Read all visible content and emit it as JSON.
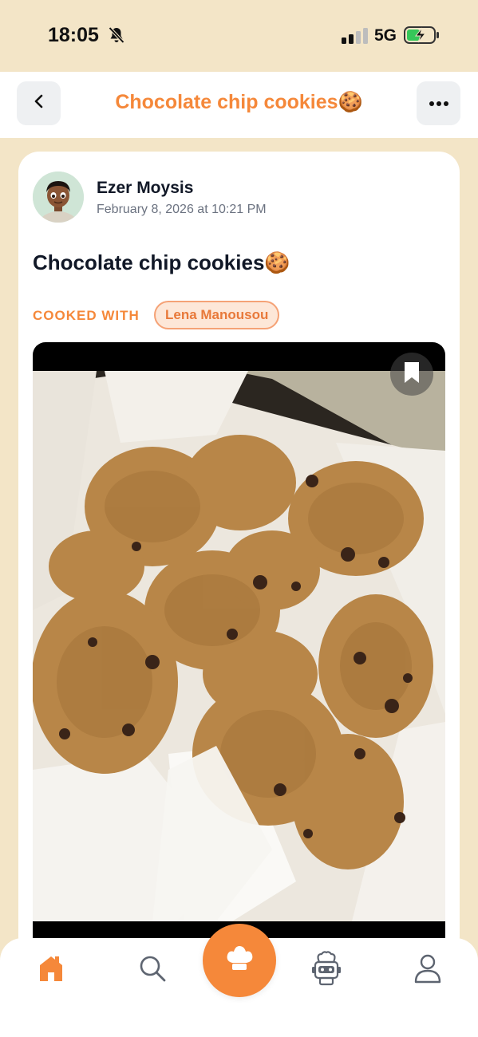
{
  "status_bar": {
    "time": "18:05",
    "network": "5G",
    "icons": [
      "bell-slash-icon",
      "signal-icon",
      "battery-charging-icon"
    ]
  },
  "header": {
    "title": "Chocolate chip cookies🍪",
    "back_icon": "chevron-left-icon",
    "more_icon": "more-horizontal-icon"
  },
  "post": {
    "author": "Ezer Moysis",
    "date": "February 8, 2026 at 10:21 PM",
    "title": "Chocolate chip cookies🍪",
    "cooked_with_label": "COOKED WITH",
    "collaborator": "Lena Manousou",
    "photo": {
      "subject": "cookie-photo",
      "bookmark_icon": "bookmark-icon"
    }
  },
  "tab_bar": {
    "tabs": [
      {
        "icon": "home-icon",
        "active": true
      },
      {
        "icon": "search-icon",
        "active": false
      },
      {
        "icon": "chef-hat-icon",
        "active": false
      },
      {
        "icon": "robot-chef-icon",
        "active": false
      },
      {
        "icon": "profile-icon",
        "active": false
      }
    ]
  },
  "colors": {
    "accent": "#f5883a",
    "background": "#f3e5c7",
    "chip_bg": "#fde7d8",
    "text": "#111827",
    "muted": "#6b7280"
  }
}
